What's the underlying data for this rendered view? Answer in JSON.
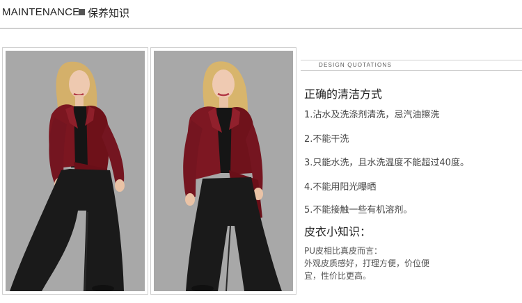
{
  "header": {
    "title_en": "MAINTENANCE",
    "title_cn": "保养知识"
  },
  "photos": [
    {
      "name": "model-photo-front"
    },
    {
      "name": "model-photo-three-quarter"
    }
  ],
  "design_quotations": {
    "label": "DESIGN QUOTATIONS"
  },
  "cleaning": {
    "title": "正确的清洁方式",
    "items": [
      "1.沾水及洗涤剂清洗，忌汽油擦洗",
      "2.不能干洗",
      "3.只能水洗，且水洗温度不能超过40度。",
      "4.不能用阳光曝晒",
      "5.不能接触一些有机溶剂。"
    ]
  },
  "knowledge": {
    "title": "皮衣小知识：",
    "lines": [
      "PU皮相比真皮而言：",
      "外观皮质感好，打理方便，价位便",
      "宜，性价比更高。"
    ]
  },
  "colors": {
    "background": "#ffffff",
    "photo_backdrop": "#a7a7a7",
    "jacket": "#7b1620",
    "pants": "#1a1a1a",
    "hair": "#d7b46a"
  }
}
